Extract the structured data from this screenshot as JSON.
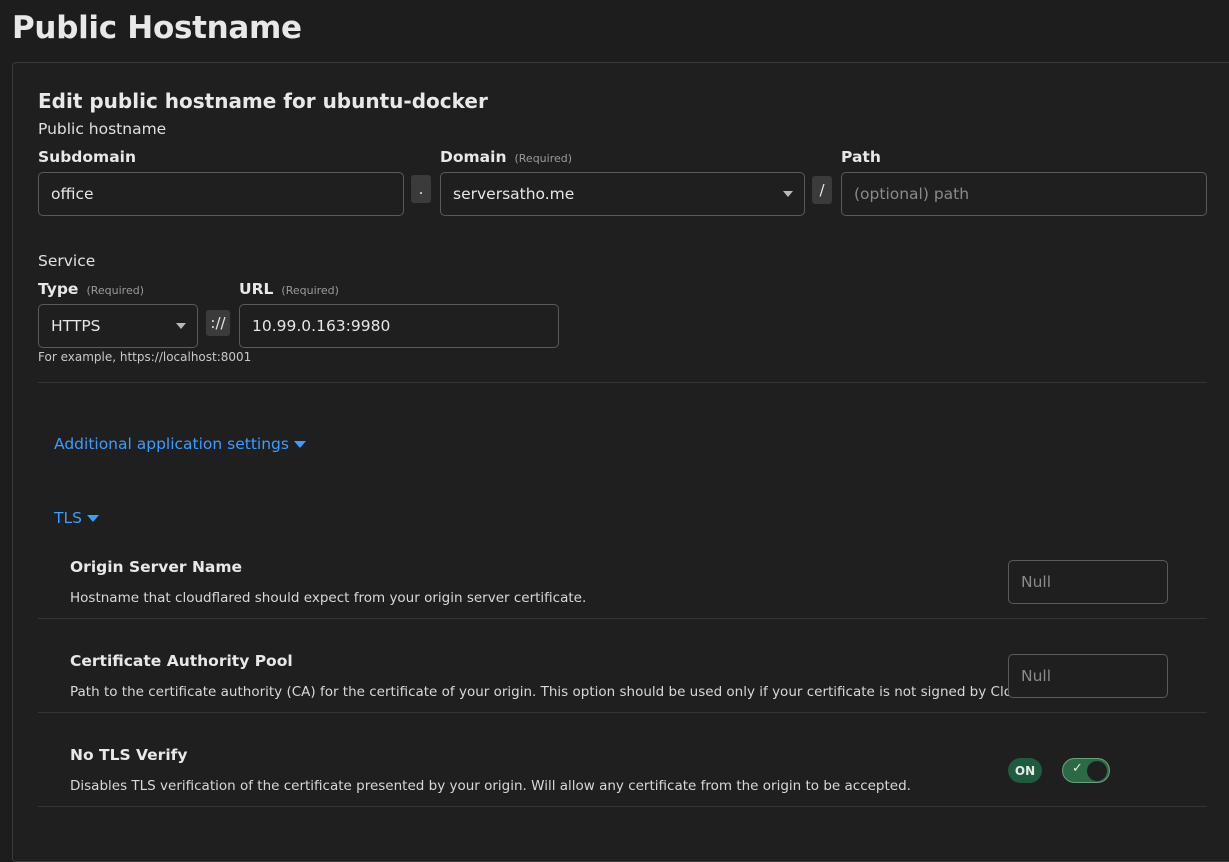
{
  "page": {
    "title": "Public Hostname"
  },
  "form": {
    "heading": "Edit public hostname for ubuntu-docker",
    "public_hostname_label": "Public hostname",
    "subdomain": {
      "label": "Subdomain",
      "value": "office"
    },
    "dot_separator": ".",
    "domain": {
      "label": "Domain",
      "required": "(Required)",
      "value": "serversatho.me"
    },
    "slash_separator": "/",
    "path": {
      "label": "Path",
      "placeholder": "(optional) path"
    },
    "service_label": "Service",
    "type": {
      "label": "Type",
      "required": "(Required)",
      "value": "HTTPS"
    },
    "scheme_separator": "://",
    "url": {
      "label": "URL",
      "required": "(Required)",
      "value": "10.99.0.163:9980"
    },
    "example_hint": "For example, https://localhost:8001"
  },
  "additional_settings": {
    "label": "Additional application settings"
  },
  "tls": {
    "label": "TLS",
    "settings": [
      {
        "name": "Origin Server Name",
        "description": "Hostname that cloudflared should expect from your origin server certificate.",
        "placeholder": "Null"
      },
      {
        "name": "Certificate Authority Pool",
        "description": "Path to the certificate authority (CA) for the certificate of your origin. This option should be used only if your certificate is not signed by Cloudflare.",
        "placeholder": "Null"
      },
      {
        "name": "No TLS Verify",
        "description": "Disables TLS verification of the certificate presented by your origin. Will allow any certificate from the origin to be accepted.",
        "state_label": "ON",
        "enabled": true,
        "check_glyph": "✓"
      }
    ]
  },
  "colors": {
    "background": "#1d1d1d",
    "link": "#3b9dff",
    "toggle_on": "#2a6b45",
    "badge_on": "#1f5b3f"
  }
}
